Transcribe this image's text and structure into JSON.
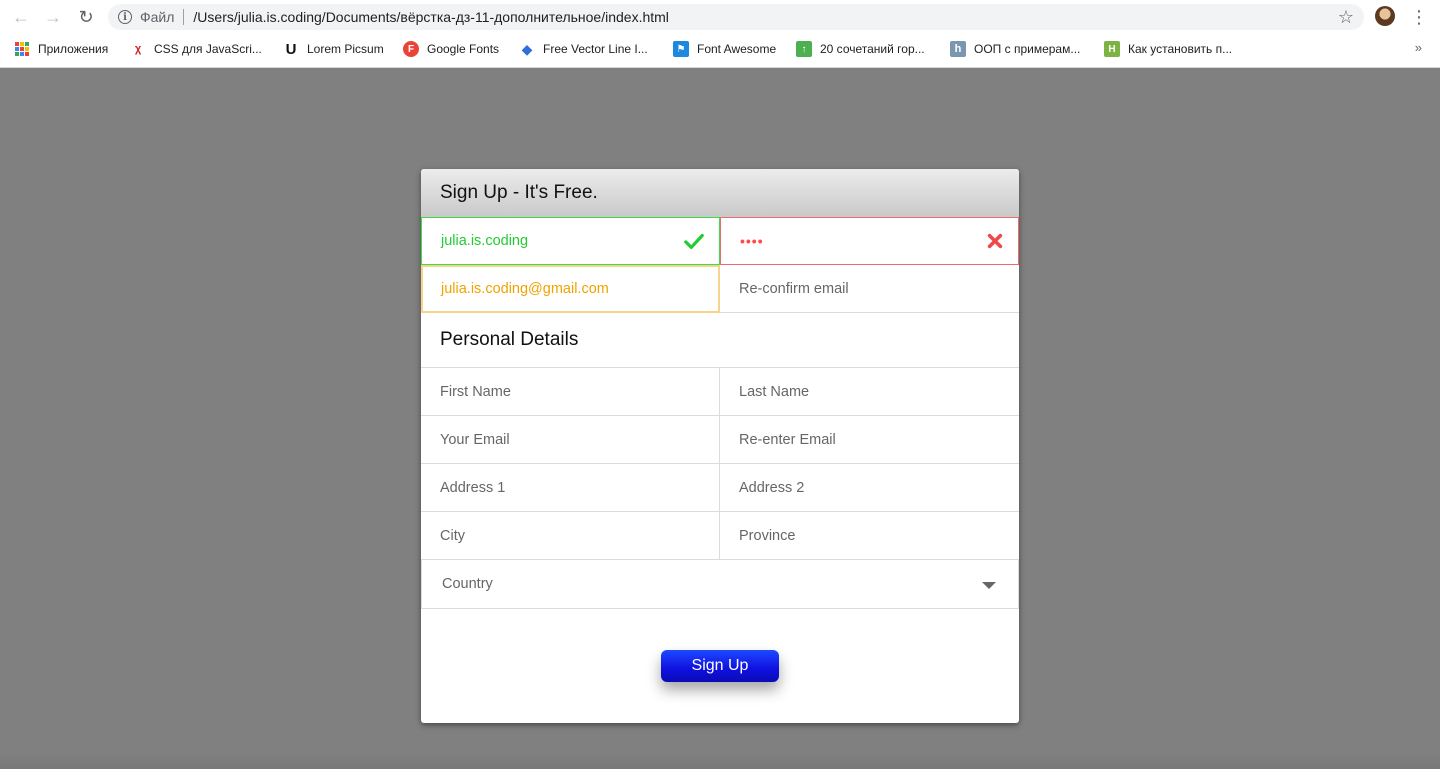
{
  "browser": {
    "scheme_label": "Файл",
    "url": "/Users/julia.is.coding/Documents/вёрстка-дз-11-дополнительное/index.html",
    "bookmarks": [
      {
        "label": "Приложения",
        "icon": "apps-grid-icon"
      },
      {
        "label": "CSS для JavaScri...",
        "icon": "css-figure-icon"
      },
      {
        "label": "Lorem Picsum",
        "icon": "lorem-picsum-icon"
      },
      {
        "label": "Google Fonts",
        "icon": "google-fonts-icon"
      },
      {
        "label": "Free Vector Line I...",
        "icon": "diamond-icon"
      },
      {
        "label": "Font Awesome",
        "icon": "font-awesome-flag-icon"
      },
      {
        "label": "20 сочетаний гор...",
        "icon": "site-green-icon"
      },
      {
        "label": "ООП с примерам...",
        "icon": "habr-icon"
      },
      {
        "label": "Как установить п...",
        "icon": "site-green-h-icon"
      }
    ],
    "more_label": "»"
  },
  "form": {
    "title": "Sign Up - It's Free.",
    "username": {
      "value": "julia.is.coding",
      "state": "valid"
    },
    "password": {
      "value": "••••",
      "state": "invalid"
    },
    "email": {
      "value": "julia.is.coding@gmail.com",
      "state": "focused"
    },
    "reconfirm_email": {
      "placeholder": "Re-confirm email"
    },
    "section_title": "Personal Details",
    "first_name": {
      "placeholder": "First Name"
    },
    "last_name": {
      "placeholder": "Last Name"
    },
    "your_email": {
      "placeholder": "Your Email"
    },
    "reenter_email": {
      "placeholder": "Re-enter Email"
    },
    "address1": {
      "placeholder": "Address 1"
    },
    "address2": {
      "placeholder": "Address 2"
    },
    "city": {
      "placeholder": "City"
    },
    "province": {
      "placeholder": "Province"
    },
    "country": {
      "selected": "Country"
    },
    "submit_label": "Sign Up"
  },
  "colors": {
    "valid": "#22cc33",
    "invalid": "#ff3b3b",
    "focus": "#f0a300",
    "button": "#1010e0",
    "backdrop": "#808080"
  }
}
